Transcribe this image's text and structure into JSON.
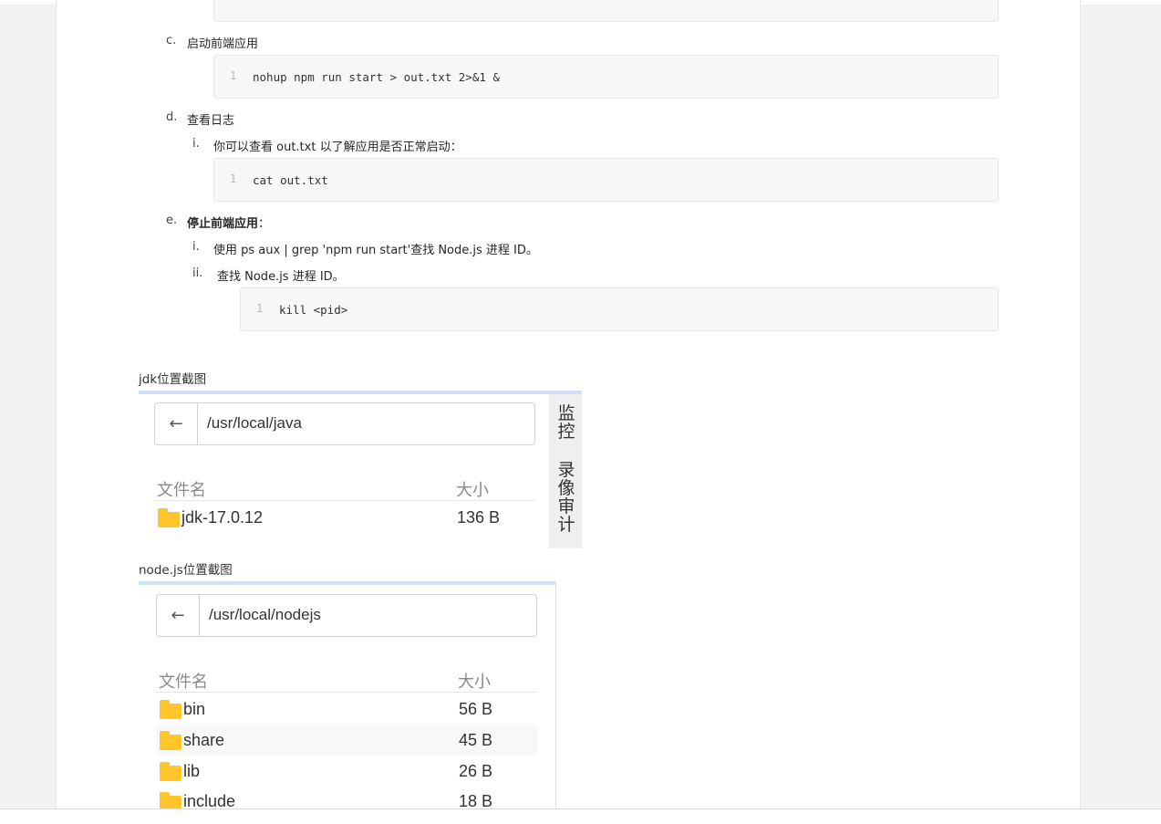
{
  "steps": {
    "c": {
      "marker": "c.",
      "label": "启动前端应用",
      "code_line_no": "1",
      "code": "nohup npm run start > out.txt 2>&1 &"
    },
    "d": {
      "marker": "d.",
      "label": "查看日志",
      "sub_i": {
        "marker": "i.",
        "text": "你可以查看 out.txt 以了解应用是否正常启动："
      },
      "code_line_no": "1",
      "code": "cat out.txt"
    },
    "e": {
      "marker": "e.",
      "label_bold": "停止前端应用",
      "label_suffix": "：",
      "sub_i": {
        "marker": "i.",
        "text": "使用 ps aux | grep 'npm run start'查找 Node.js 进程 ID。"
      },
      "sub_ii": {
        "marker": "ii.",
        "text": "查找 Node.js 进程 ID。"
      },
      "code_line_no": "1",
      "code": "kill <pid>"
    }
  },
  "jdk_shot": {
    "caption": "jdk位置截图",
    "back_icon": "←",
    "path": "/usr/local/java",
    "col_name": "文件名",
    "col_size": "大小",
    "rows": [
      {
        "name": "jdk-17.0.12",
        "size": "136 B"
      }
    ],
    "side_labels": [
      "监",
      "控",
      "录",
      "像",
      "审",
      "计"
    ]
  },
  "node_shot": {
    "caption": "node.js位置截图",
    "back_icon": "←",
    "path": "/usr/local/nodejs",
    "col_name": "文件名",
    "col_size": "大小",
    "rows": [
      {
        "name": "bin",
        "size": "56 B"
      },
      {
        "name": "share",
        "size": "45 B"
      },
      {
        "name": "lib",
        "size": "26 B"
      },
      {
        "name": "include",
        "size": "18 B"
      }
    ]
  },
  "colors": {
    "folder": "#ffc52b",
    "shot_top_border": "#cfe0f5",
    "code_bg": "#f7f7f7"
  }
}
